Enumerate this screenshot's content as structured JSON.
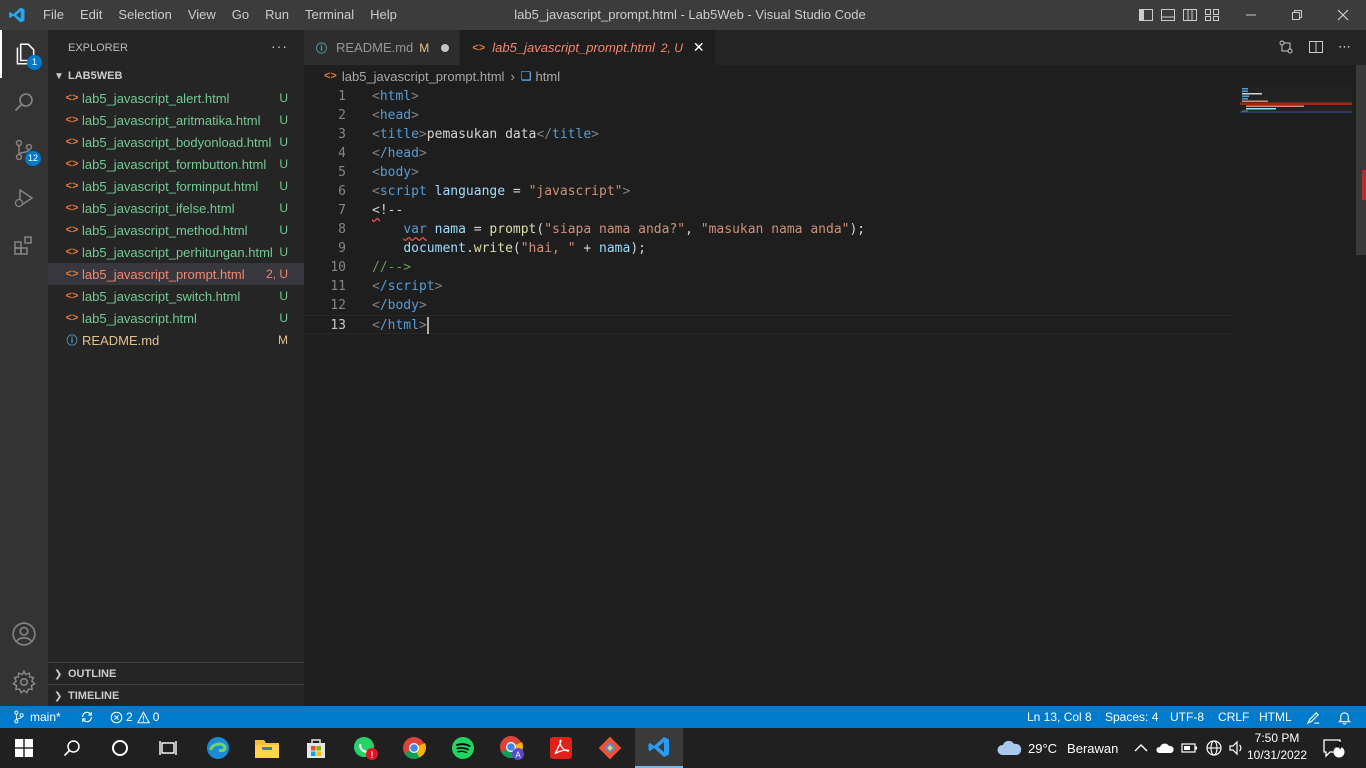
{
  "titlebar": {
    "menus": [
      "File",
      "Edit",
      "Selection",
      "View",
      "Go",
      "Run",
      "Terminal",
      "Help"
    ],
    "title": "lab5_javascript_prompt.html - Lab5Web - Visual Studio Code"
  },
  "activity": {
    "explorer_badge": "1",
    "scm_badge": "12"
  },
  "sidebar": {
    "header": "EXPLORER",
    "more": "···",
    "folder": "LAB5WEB",
    "files": [
      {
        "name": "lab5_javascript_alert.html",
        "status": "U"
      },
      {
        "name": "lab5_javascript_aritmatika.html",
        "status": "U"
      },
      {
        "name": "lab5_javascript_bodyonload.html",
        "status": "U"
      },
      {
        "name": "lab5_javascript_formbutton.html",
        "status": "U"
      },
      {
        "name": "lab5_javascript_forminput.html",
        "status": "U"
      },
      {
        "name": "lab5_javascript_ifelse.html",
        "status": "U"
      },
      {
        "name": "lab5_javascript_method.html",
        "status": "U"
      },
      {
        "name": "lab5_javascript_perhitungan.html",
        "status": "U"
      },
      {
        "name": "lab5_javascript_prompt.html",
        "status": "2, U"
      },
      {
        "name": "lab5_javascript_switch.html",
        "status": "U"
      },
      {
        "name": "lab5_javascript.html",
        "status": "U"
      },
      {
        "name": "README.md",
        "status": "M"
      }
    ],
    "outline": "OUTLINE",
    "timeline": "TIMELINE"
  },
  "tabs": [
    {
      "label": "README.md",
      "status": "M"
    },
    {
      "label": "lab5_javascript_prompt.html",
      "status": "2, U"
    }
  ],
  "breadcrumb": {
    "file": "lab5_javascript_prompt.html",
    "symbol": "html"
  },
  "editor": {
    "line_numbers": [
      "1",
      "2",
      "3",
      "4",
      "5",
      "6",
      "7",
      "8",
      "9",
      "10",
      "11",
      "12",
      "13"
    ],
    "lines": {
      "l1_tag": "html",
      "l2_tag": "head",
      "l3_tag": "title",
      "l3_text": "pemasukan data",
      "l4_tag": "/head",
      "l5_tag": "body",
      "l6_tag": "script",
      "l6_attr": "languange",
      "l6_eq": " = ",
      "l6_val": "\"javascript\"",
      "l7_open": "<",
      "l7_rest": "!--",
      "l8_kw": "var",
      "l8_var": "nama",
      "l8_eq": " = ",
      "l8_fn": "prompt",
      "l8_p1": "(",
      "l8_s1": "\"siapa nama anda?\"",
      "l8_comma": ", ",
      "l8_s2": "\"masukan nama anda\"",
      "l8_end": ");",
      "l9_obj": "document",
      "l9_dot": ".",
      "l9_fn": "write",
      "l9_p1": "(",
      "l9_s1": "\"hai, \"",
      "l9_plus": " + ",
      "l9_var": "nama",
      "l9_end": ");",
      "l10": "//-->",
      "l11_tag": "/script",
      "l12_tag": "/body",
      "l13_tag": "/html"
    }
  },
  "statusbar": {
    "branch": "main*",
    "errors": "2",
    "warnings": "0",
    "position": "Ln 13, Col 8",
    "spaces": "Spaces: 4",
    "encoding": "UTF-8",
    "eol": "CRLF",
    "language": "HTML"
  },
  "taskbar": {
    "weather_temp": "29°C",
    "weather_desc": "Berawan",
    "time": "7:50 PM",
    "date": "10/31/2022",
    "notifications": "4"
  },
  "colors": {
    "accent": "#007acc",
    "untracked": "#73c991",
    "error": "#f48771",
    "modified": "#e2c08d"
  }
}
